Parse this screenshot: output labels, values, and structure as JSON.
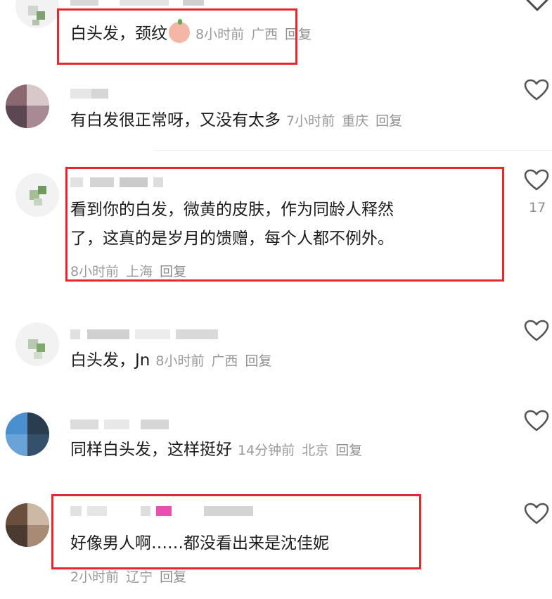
{
  "comments": [
    {
      "id": "c1",
      "text": "白头发，颈纹",
      "has_emoji": true,
      "time": "8小时前",
      "location": "广西",
      "reply": "回复",
      "like_count": ""
    },
    {
      "id": "c2",
      "text": "有白发很正常呀，又没有太多",
      "time": "7小时前",
      "location": "重庆",
      "reply": "回复",
      "like_count": ""
    },
    {
      "id": "c3",
      "text_line1": "看到你的白发，微黄的皮肤，作为同龄人释然",
      "text_line2": "了，这真的是岁月的馈赠，每个人都不例外。",
      "time": "8小时前",
      "location": "上海",
      "reply": "回复",
      "like_count": "17"
    },
    {
      "id": "c4",
      "text": "白头发，Jn",
      "time": "8小时前",
      "location": "广西",
      "reply": "回复",
      "like_count": ""
    },
    {
      "id": "c5",
      "text": "同样白头发，这样挺好",
      "time": "14分钟前",
      "location": "北京",
      "reply": "回复",
      "like_count": ""
    },
    {
      "id": "c6",
      "text": "好像男人啊……都没看出来是沈佳妮",
      "time": "2小时前",
      "location": "辽宁",
      "reply": "回复",
      "like_count": ""
    }
  ],
  "icons": {
    "like": "heart-outline-icon",
    "expand": "chevron-down-icon"
  },
  "colors": {
    "highlight": "#e8262d",
    "meta": "#9a9a9a",
    "text": "#1c1c1c"
  }
}
